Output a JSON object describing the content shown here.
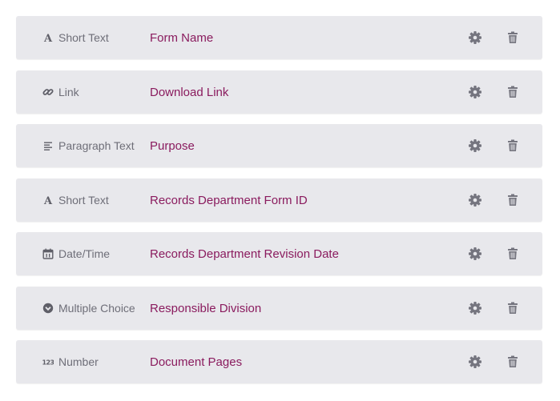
{
  "colors": {
    "row_bg": "#e8e8ec",
    "type_text": "#6e6e78",
    "field_label": "#8a1b5e",
    "icon": "#75757f"
  },
  "fields": [
    {
      "type_label": "Short Text",
      "type_icon": "letter-a-icon",
      "label": "Form Name"
    },
    {
      "type_label": "Link",
      "type_icon": "link-icon",
      "label": "Download Link"
    },
    {
      "type_label": "Paragraph Text",
      "type_icon": "paragraph-icon",
      "label": "Purpose"
    },
    {
      "type_label": "Short Text",
      "type_icon": "letter-a-icon",
      "label": "Records Department Form ID"
    },
    {
      "type_label": "Date/Time",
      "type_icon": "calendar-icon",
      "label": "Records Department Revision Date"
    },
    {
      "type_label": "Multiple Choice",
      "type_icon": "chevron-circle-icon",
      "label": "Responsible Division"
    },
    {
      "type_label": "Number",
      "type_icon": "number-123-icon",
      "label": "Document Pages"
    }
  ],
  "actions": {
    "settings_icon": "gear-icon",
    "delete_icon": "trash-icon"
  }
}
